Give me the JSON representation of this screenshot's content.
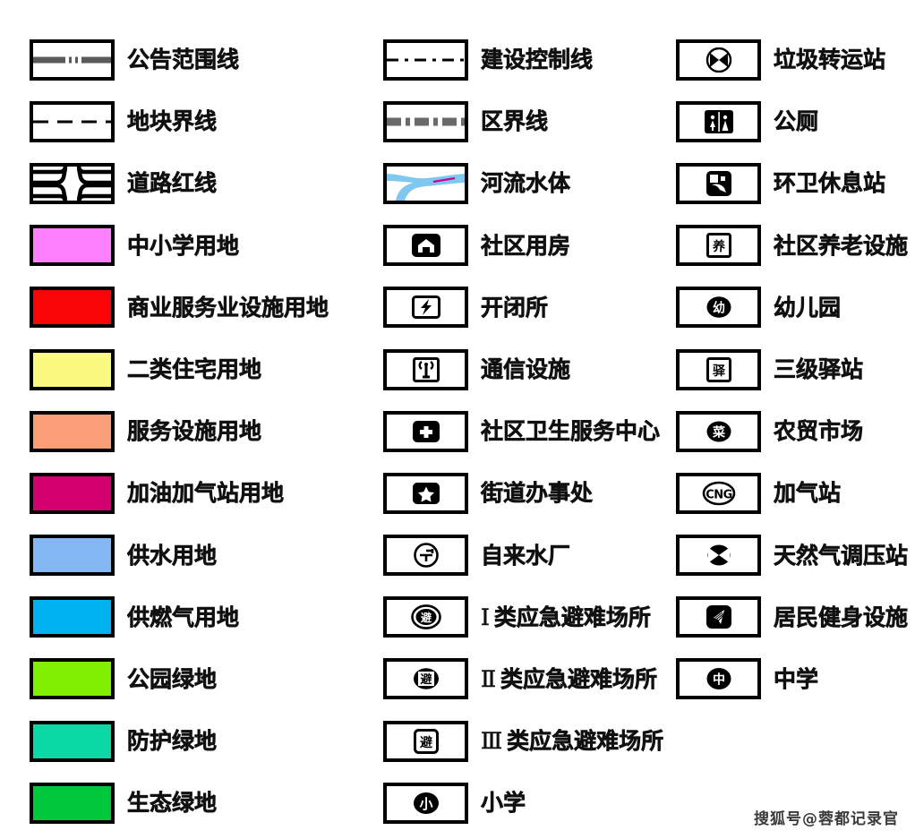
{
  "legend": {
    "columns": [
      {
        "id": "col-0",
        "rows": [
          {
            "symbol_type": "line-notice",
            "label": "公告范围线",
            "color": "#5a5a5a"
          },
          {
            "symbol_type": "line-parcel",
            "label": "地块界线",
            "color": "#000000"
          },
          {
            "symbol_type": "line-road",
            "label": "道路红线",
            "color": "#000000"
          },
          {
            "symbol_type": "fill",
            "label": "中小学用地",
            "color": "#ff80ff"
          },
          {
            "symbol_type": "fill",
            "label": "商业服务业设施用地",
            "color": "#fa0505"
          },
          {
            "symbol_type": "fill",
            "label": "二类住宅用地",
            "color": "#fafa80"
          },
          {
            "symbol_type": "fill",
            "label": "服务设施用地",
            "color": "#fa9e78"
          },
          {
            "symbol_type": "fill",
            "label": "加油加气站用地",
            "color": "#d40070"
          },
          {
            "symbol_type": "fill",
            "label": "供水用地",
            "color": "#84b8f5"
          },
          {
            "symbol_type": "fill",
            "label": "供燃气用地",
            "color": "#00b3f0"
          },
          {
            "symbol_type": "fill",
            "label": "公园绿地",
            "color": "#80f000"
          },
          {
            "symbol_type": "fill",
            "label": "防护绿地",
            "color": "#0ad8a5"
          },
          {
            "symbol_type": "fill",
            "label": "生态绿地",
            "color": "#00c83c"
          }
        ]
      },
      {
        "id": "col-1",
        "rows": [
          {
            "symbol_type": "line-ctrl",
            "label": "建设控制线",
            "color": "#000000"
          },
          {
            "symbol_type": "line-district",
            "label": "区界线",
            "color": "#6a6a6a"
          },
          {
            "symbol_type": "river",
            "label": "河流水体",
            "color": "#7ec8f0"
          },
          {
            "symbol_type": "icon-house",
            "label": "社区用房",
            "color": "#000000"
          },
          {
            "symbol_type": "icon-bolt",
            "label": "开闭所",
            "color": "#000000"
          },
          {
            "symbol_type": "icon-antenna",
            "label": "通信设施",
            "color": "#000000"
          },
          {
            "symbol_type": "icon-cross",
            "label": "社区卫生服务中心",
            "color": "#000000"
          },
          {
            "symbol_type": "icon-star",
            "label": "街道办事处",
            "color": "#000000"
          },
          {
            "symbol_type": "icon-water",
            "label": "自来水厂",
            "color": "#000000"
          },
          {
            "symbol_type": "icon-shelter-1",
            "label": "类应急避难场所",
            "roman": "Ⅰ",
            "glyph": "避",
            "color": "#000000"
          },
          {
            "symbol_type": "icon-shelter-2",
            "label": "类应急避难场所",
            "roman": "Ⅱ",
            "glyph": "避",
            "color": "#000000"
          },
          {
            "symbol_type": "icon-shelter-3",
            "label": "类应急避难场所",
            "roman": "Ⅲ",
            "glyph": "避",
            "color": "#000000"
          },
          {
            "symbol_type": "icon-primary-school",
            "label": "小学",
            "glyph": "小",
            "color": "#000000"
          }
        ]
      },
      {
        "id": "col-2",
        "rows": [
          {
            "symbol_type": "icon-garbage",
            "label": "垃圾转运站",
            "color": "#000000"
          },
          {
            "symbol_type": "icon-toilet",
            "label": "公厕",
            "color": "#000000"
          },
          {
            "symbol_type": "icon-sanitation-rest",
            "label": "环卫休息站",
            "color": "#000000"
          },
          {
            "symbol_type": "icon-elderly",
            "label": "社区养老设施",
            "glyph": "养",
            "color": "#000000"
          },
          {
            "symbol_type": "icon-kindergarten",
            "label": "幼儿园",
            "glyph": "幼",
            "color": "#000000"
          },
          {
            "symbol_type": "icon-post",
            "label": "三级驿站",
            "glyph": "驿",
            "color": "#000000"
          },
          {
            "symbol_type": "icon-market",
            "label": "农贸市场",
            "glyph": "菜",
            "color": "#000000"
          },
          {
            "symbol_type": "icon-cng",
            "label": "加气站",
            "glyph": "CNG",
            "color": "#000000"
          },
          {
            "symbol_type": "icon-gas-regulator",
            "label": "天然气调压站",
            "color": "#000000"
          },
          {
            "symbol_type": "icon-fitness",
            "label": "居民健身设施",
            "color": "#000000"
          },
          {
            "symbol_type": "icon-middle-school",
            "label": "中学",
            "glyph": "中",
            "color": "#000000"
          }
        ]
      }
    ]
  },
  "watermark": {
    "text": "搜狐号@蓉都记录官"
  }
}
